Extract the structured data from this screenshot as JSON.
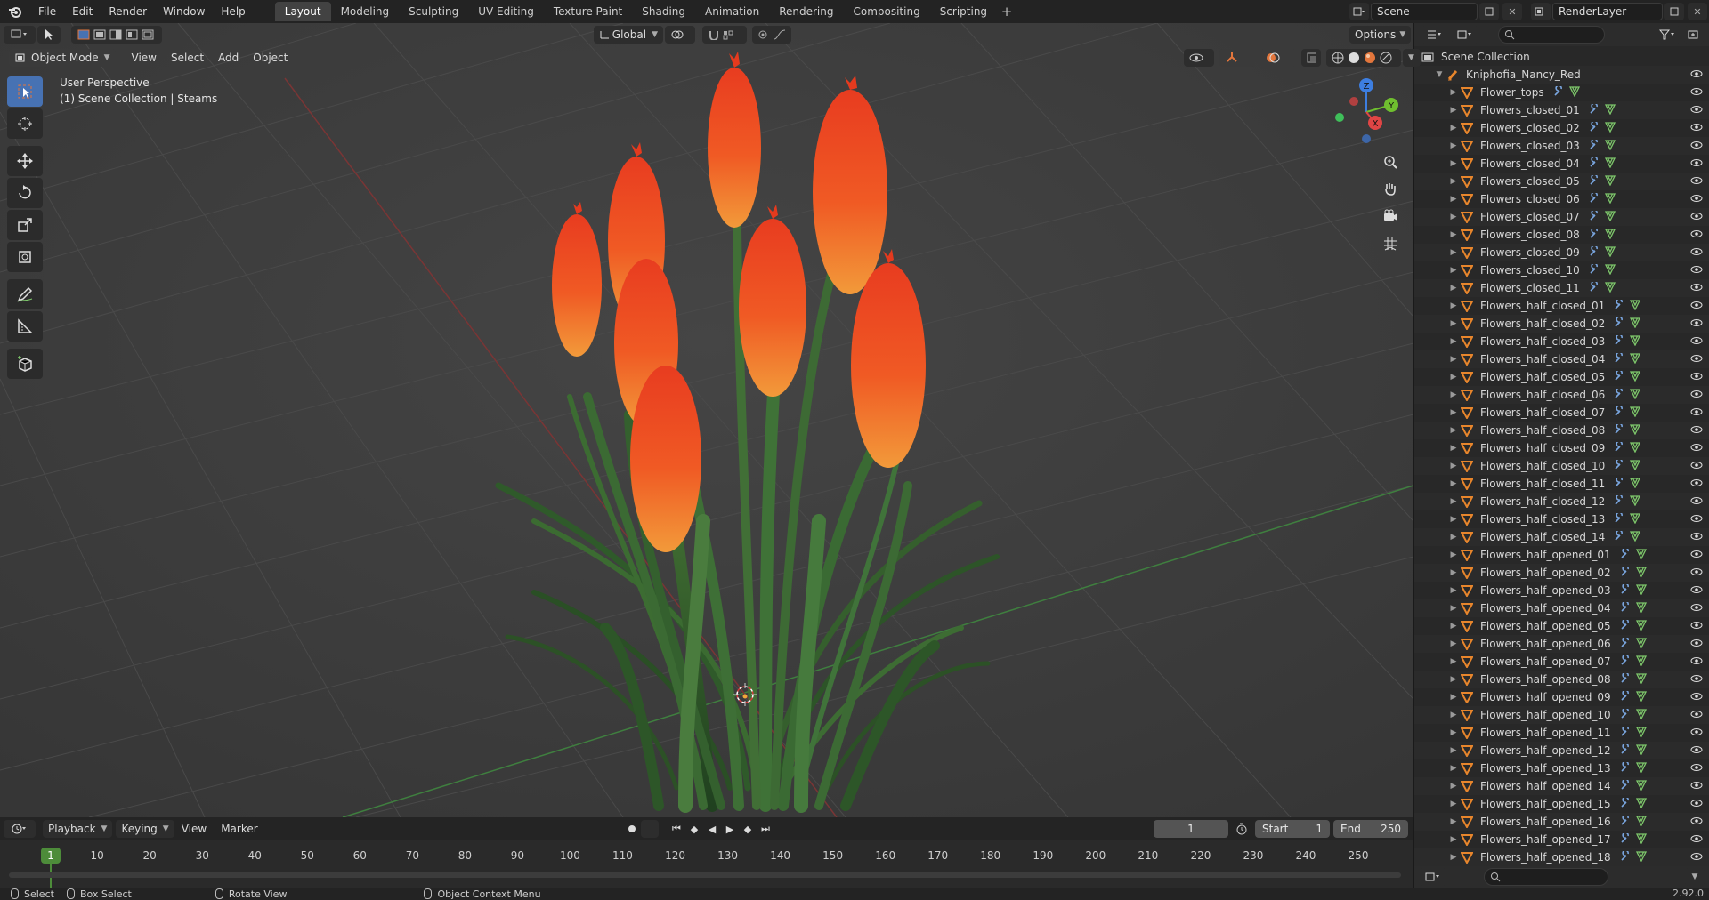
{
  "topbar": {
    "menus": [
      "File",
      "Edit",
      "Render",
      "Window",
      "Help"
    ],
    "workspaces": [
      "Layout",
      "Modeling",
      "Sculpting",
      "UV Editing",
      "Texture Paint",
      "Shading",
      "Animation",
      "Rendering",
      "Compositing",
      "Scripting"
    ],
    "active_workspace": "Layout",
    "add_tab": "+",
    "scene_name": "Scene",
    "view_layer": "RenderLayer"
  },
  "viewport": {
    "mode": "Object Mode",
    "menus": [
      "View",
      "Select",
      "Add",
      "Object"
    ],
    "transform_orientation": "Global",
    "options_label": "Options",
    "perspective_label": "User Perspective",
    "collection_label": "(1) Scene Collection | Steams",
    "gizmo_axes": [
      "Z",
      "Y",
      "X"
    ]
  },
  "timeline": {
    "menus_dd": [
      "Playback",
      "Keying"
    ],
    "menus": [
      "View",
      "Marker"
    ],
    "current_frame": "1",
    "start_label": "Start",
    "start_value": "1",
    "end_label": "End",
    "end_value": "250",
    "ruler_ticks": [
      "10",
      "20",
      "30",
      "40",
      "50",
      "60",
      "70",
      "80",
      "90",
      "100",
      "110",
      "120",
      "130",
      "140",
      "150",
      "160",
      "170",
      "180",
      "190",
      "200",
      "210",
      "220",
      "230",
      "240",
      "250"
    ],
    "ruler_current": "1"
  },
  "statusbar": {
    "items": [
      "Select",
      "Box Select",
      "Rotate View",
      "Object Context Menu"
    ],
    "version": "2.92.0"
  },
  "outliner": {
    "root": "Scene Collection",
    "collection": "Kniphofia_Nancy_Red",
    "objects": [
      "Flower_tops",
      "Flowers_closed_01",
      "Flowers_closed_02",
      "Flowers_closed_03",
      "Flowers_closed_04",
      "Flowers_closed_05",
      "Flowers_closed_06",
      "Flowers_closed_07",
      "Flowers_closed_08",
      "Flowers_closed_09",
      "Flowers_closed_10",
      "Flowers_closed_11",
      "Flowers_half_closed_01",
      "Flowers_half_closed_02",
      "Flowers_half_closed_03",
      "Flowers_half_closed_04",
      "Flowers_half_closed_05",
      "Flowers_half_closed_06",
      "Flowers_half_closed_07",
      "Flowers_half_closed_08",
      "Flowers_half_closed_09",
      "Flowers_half_closed_10",
      "Flowers_half_closed_11",
      "Flowers_half_closed_12",
      "Flowers_half_closed_13",
      "Flowers_half_closed_14",
      "Flowers_half_opened_01",
      "Flowers_half_opened_02",
      "Flowers_half_opened_03",
      "Flowers_half_opened_04",
      "Flowers_half_opened_05",
      "Flowers_half_opened_06",
      "Flowers_half_opened_07",
      "Flowers_half_opened_08",
      "Flowers_half_opened_09",
      "Flowers_half_opened_10",
      "Flowers_half_opened_11",
      "Flowers_half_opened_12",
      "Flowers_half_opened_13",
      "Flowers_half_opened_14",
      "Flowers_half_opened_15",
      "Flowers_half_opened_16",
      "Flowers_half_opened_17",
      "Flowers_half_opened_18"
    ]
  },
  "colors": {
    "accent": "#4772b3",
    "frame_green": "#4d8c3a",
    "object_orange": "#e8862c",
    "modifier_blue": "#7aa6e0",
    "mesh_green": "#7ec86b",
    "flower_red": "#e6401f"
  }
}
